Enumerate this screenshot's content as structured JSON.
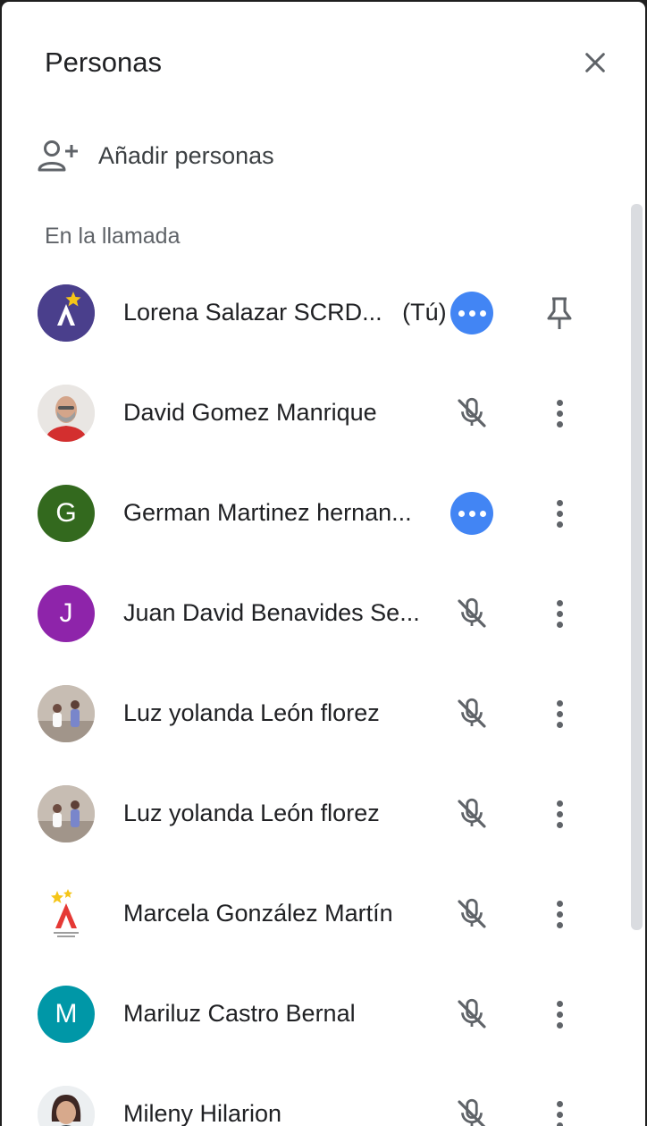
{
  "header": {
    "title": "Personas",
    "close_icon": "close-icon"
  },
  "add_people": {
    "label": "Añadir personas",
    "icon": "person-add-icon"
  },
  "section": {
    "label": "En la llamada"
  },
  "colors": {
    "speaking": "#4285f4",
    "avatar_green": "#33691e",
    "avatar_purple": "#8e24aa",
    "avatar_teal": "#0097a7",
    "avatar_navy": "#4a3f8c"
  },
  "participants": [
    {
      "name": "Lorena Salazar SCRD...",
      "you_label": "(Tú)",
      "avatar": "logo",
      "status": "speaking-indicator-icon",
      "action": "pin-icon"
    },
    {
      "name": "David Gomez Manrique",
      "avatar": "photo",
      "status": "mic-off-icon",
      "action": "more-vert-icon"
    },
    {
      "name": "German Martinez hernan...",
      "avatar_initial": "G",
      "status": "speaking-indicator-icon",
      "action": "more-vert-icon"
    },
    {
      "name": "Juan David Benavides Se...",
      "avatar_initial": "J",
      "status": "mic-off-icon",
      "action": "more-vert-icon"
    },
    {
      "name": "Luz yolanda León florez",
      "avatar": "photo",
      "status": "mic-off-icon",
      "action": "more-vert-icon"
    },
    {
      "name": "Luz yolanda León florez",
      "avatar": "photo",
      "status": "mic-off-icon",
      "action": "more-vert-icon"
    },
    {
      "name": "Marcela González Martín",
      "avatar": "logo",
      "status": "mic-off-icon",
      "action": "more-vert-icon"
    },
    {
      "name": "Mariluz Castro Bernal",
      "avatar_initial": "M",
      "status": "mic-off-icon",
      "action": "more-vert-icon"
    },
    {
      "name": "Mileny Hilarion",
      "avatar": "photo",
      "status": "mic-off-icon",
      "action": "more-vert-icon"
    }
  ]
}
